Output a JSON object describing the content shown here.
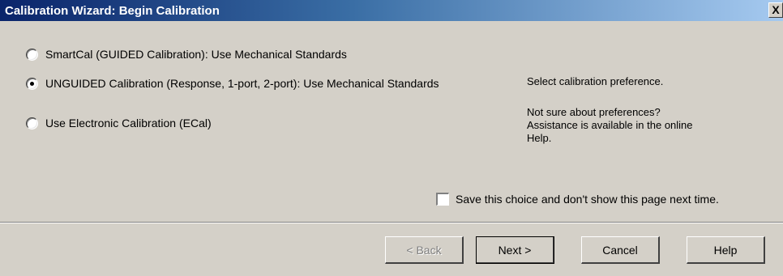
{
  "window": {
    "title": "Calibration Wizard: Begin Calibration",
    "close_glyph": "X"
  },
  "options": [
    {
      "label": "SmartCal (GUIDED Calibration): Use Mechanical Standards",
      "checked": false
    },
    {
      "label": "UNGUIDED Calibration (Response, 1-port, 2-port): Use Mechanical Standards",
      "checked": true
    },
    {
      "label": "Use Electronic Calibration (ECal)",
      "checked": false
    }
  ],
  "info": {
    "prompt": "Select calibration preference.",
    "help_line1": "Not sure about preferences?",
    "help_line2": "Assistance is available in the online",
    "help_line3": "Help."
  },
  "save_choice": {
    "label": "Save this choice and don't show this page next time.",
    "checked": false
  },
  "buttons": {
    "back": "< Back",
    "next": "Next >",
    "cancel": "Cancel",
    "help": "Help"
  }
}
